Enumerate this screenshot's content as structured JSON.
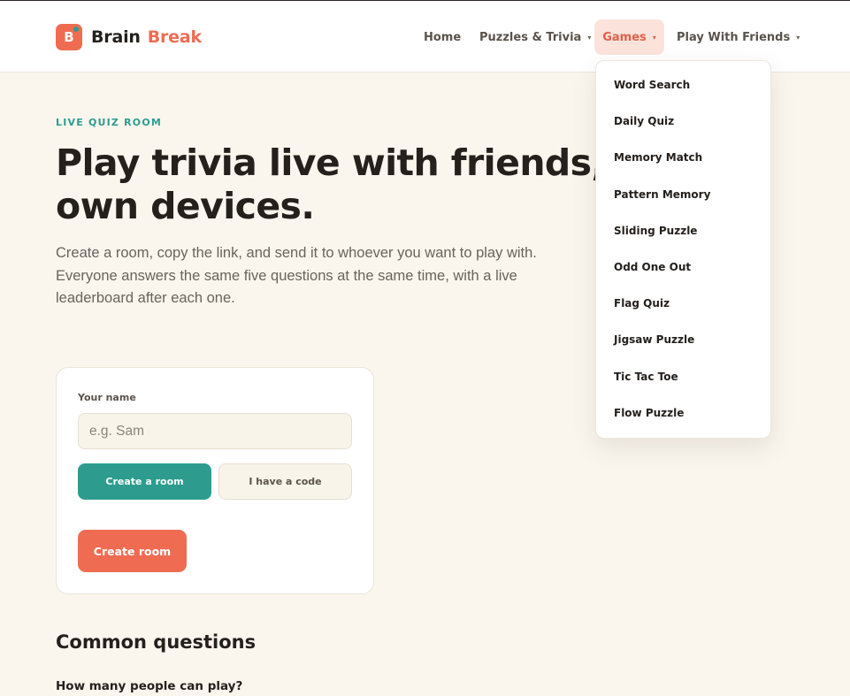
{
  "brand": {
    "badge_letter": "B",
    "word1": "Brain",
    "word2": "Break"
  },
  "nav": {
    "home": "Home",
    "puzzles": "Puzzles & Trivia",
    "games": "Games",
    "friends": "Play With Friends",
    "caret": "▾"
  },
  "hero": {
    "eyebrow": "LIVE QUIZ ROOM",
    "title_line1": "Play trivia live with friends, on your",
    "title_line2": "own devices.",
    "description": "Create a room, copy the link, and send it to whoever you want to play with. Everyone answers the same five questions at the same time, with a live leaderboard after each one."
  },
  "form": {
    "name_label": "Your name",
    "name_placeholder": "e.g. Sam",
    "name_value": "",
    "create_tab": "Create a room",
    "code_tab": "I have a code",
    "submit": "Create room"
  },
  "faq": {
    "title": "Common questions",
    "first_question": "How many people can play?"
  },
  "games_menu": {
    "items": [
      "Word Search",
      "Daily Quiz",
      "Memory Match",
      "Pattern Memory",
      "Sliding Puzzle",
      "Odd One Out",
      "Flag Quiz",
      "Jigsaw Puzzle",
      "Tic Tac Toe",
      "Flow Puzzle"
    ]
  },
  "colors": {
    "accent_coral": "#ef6c52",
    "accent_teal": "#2d9c8e",
    "background": "#faf6ee"
  }
}
